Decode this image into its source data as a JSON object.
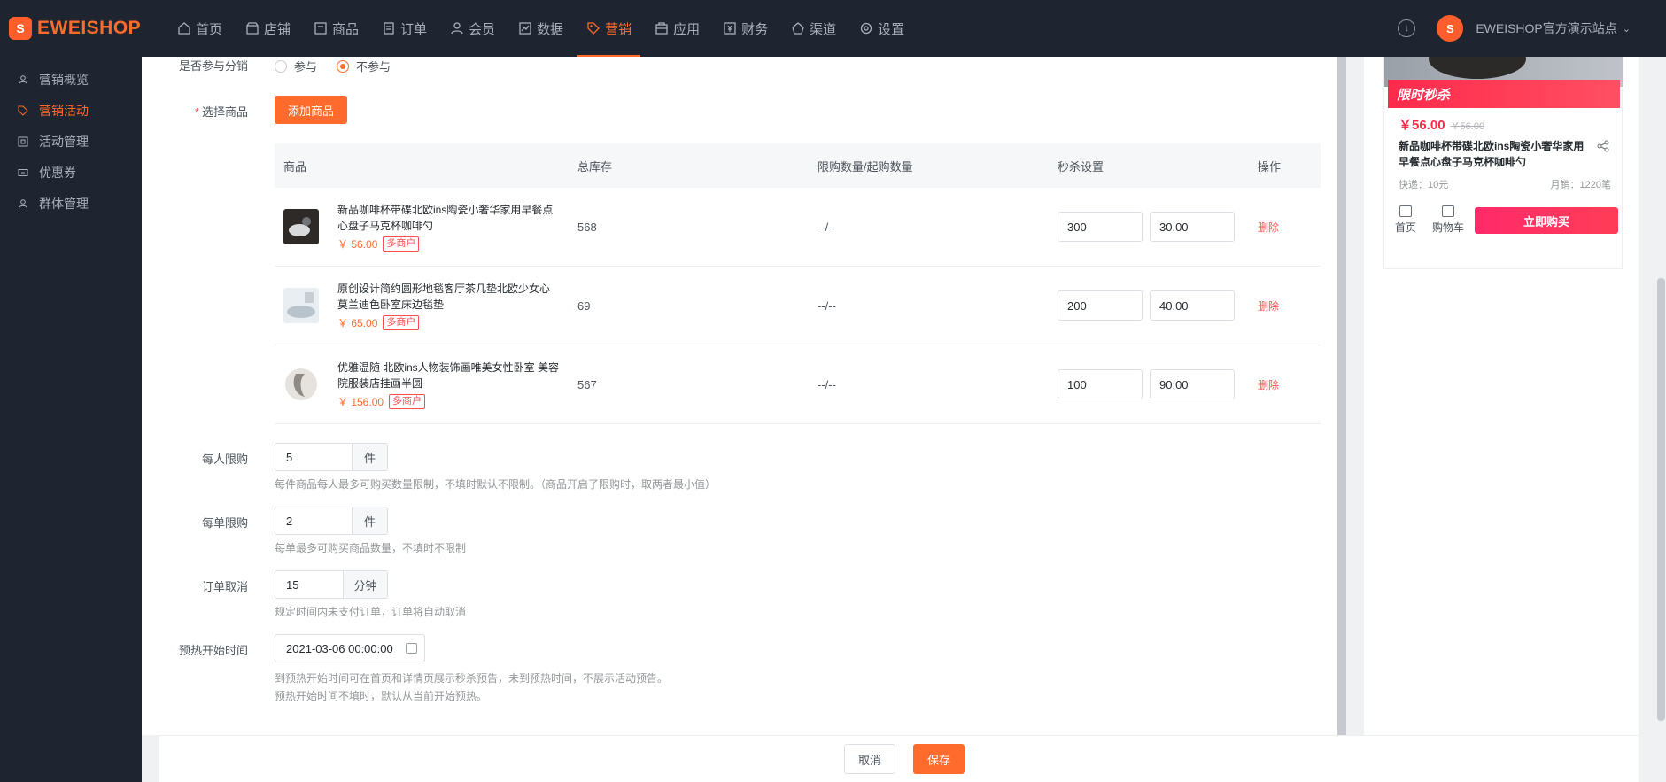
{
  "brand": {
    "name": "EWEISHOP",
    "logo_letter": "S"
  },
  "nav": {
    "items": [
      {
        "label": "首页",
        "icon": "home-icon",
        "active": false
      },
      {
        "label": "店铺",
        "icon": "store-icon",
        "active": false
      },
      {
        "label": "商品",
        "icon": "goods-icon",
        "active": false
      },
      {
        "label": "订单",
        "icon": "order-icon",
        "active": false
      },
      {
        "label": "会员",
        "icon": "member-icon",
        "active": false
      },
      {
        "label": "数据",
        "icon": "chart-icon",
        "active": false
      },
      {
        "label": "营销",
        "icon": "tag-icon",
        "active": true
      },
      {
        "label": "应用",
        "icon": "app-icon",
        "active": false
      },
      {
        "label": "财务",
        "icon": "finance-icon",
        "active": false
      },
      {
        "label": "渠道",
        "icon": "channel-icon",
        "active": false
      },
      {
        "label": "设置",
        "icon": "settings-icon",
        "active": false
      }
    ],
    "site_name": "EWEISHOP官方演示站点",
    "site_avatar_letter": "S"
  },
  "sidebar": {
    "items": [
      {
        "label": "营销概览",
        "active": false
      },
      {
        "label": "营销活动",
        "active": true
      },
      {
        "label": "活动管理",
        "active": false
      },
      {
        "label": "优惠券",
        "active": false
      },
      {
        "label": "群体管理",
        "active": false
      }
    ]
  },
  "form": {
    "distribution": {
      "label": "是否参与分销",
      "options": [
        "参与",
        "不参与"
      ],
      "selected": "不参与"
    },
    "select_goods": {
      "label": "选择商品",
      "button": "添加商品"
    },
    "table": {
      "headers": [
        "商品",
        "总库存",
        "限购数量/起购数量",
        "秒杀设置",
        "操作"
      ],
      "rows": [
        {
          "name": "新品咖啡杯带碟北欧ins陶瓷小奢华家用早餐点心盘子马克杯咖啡勺",
          "price": "￥ 56.00",
          "tag": "多商户",
          "stock": "568",
          "limit": "--/--",
          "qty": "300",
          "seckill_price": "30.00",
          "action": "删除"
        },
        {
          "name": "原创设计简约圆形地毯客厅茶几垫北欧少女心莫兰迪色卧室床边毯垫",
          "price": "￥ 65.00",
          "tag": "多商户",
          "stock": "69",
          "limit": "--/--",
          "qty": "200",
          "seckill_price": "40.00",
          "action": "删除"
        },
        {
          "name": "优雅温随 北欧ins人物装饰画唯美女性卧室 美容院服装店挂画半圆",
          "price": "￥ 156.00",
          "tag": "多商户",
          "stock": "567",
          "limit": "--/--",
          "qty": "100",
          "seckill_price": "90.00",
          "action": "删除"
        }
      ]
    },
    "per_person": {
      "label": "每人限购",
      "value": "5",
      "unit": "件",
      "help": "每件商品每人最多可购买数量限制，不填时默认不限制。（商品开启了限购时，取两者最小值）"
    },
    "per_order": {
      "label": "每单限购",
      "value": "2",
      "unit": "件",
      "help": "每单最多可购买商品数量，不填时不限制"
    },
    "order_cancel": {
      "label": "订单取消",
      "value": "15",
      "unit": "分钟",
      "help": "规定时间内未支付订单，订单将自动取消"
    },
    "preheat": {
      "label": "预热开始时间",
      "value": "2021-03-06 00:00:00",
      "help1": "到预热开始时间可在首页和详情页展示秒杀预告，未到预热时间，不展示活动预告。",
      "help2": "预热开始时间不填时，默认从当前开始预热。"
    }
  },
  "footer": {
    "cancel": "取消",
    "save": "保存"
  },
  "preview": {
    "flash_label": "限时秒杀",
    "price_now": "￥56.00",
    "price_old": "￥56.00",
    "title": "新品咖啡杯带碟北欧ins陶瓷小奢华家用早餐点心盘子马克杯咖啡勺",
    "shipping": "快递：10元",
    "sales": "月销：1220笔",
    "home": "首页",
    "cart": "购物车",
    "buy": "立即购买"
  },
  "colors": {
    "accent": "#ff6b2c",
    "nav_bg": "#1f2530",
    "danger": "#ff4d4f",
    "flash": "#ff2a4c"
  }
}
